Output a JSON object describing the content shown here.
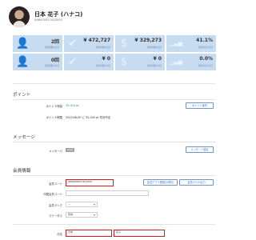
{
  "header": {
    "name": "日本 花子 (ハナコ)",
    "member_id": "A860000274U3000"
  },
  "stats": [
    {
      "icon": "user-icon",
      "glyph": "👤",
      "value": "2回",
      "label": "利用回数の合計"
    },
    {
      "icon": "check-icon",
      "glyph": "✔",
      "value": "¥ 472,727",
      "label": "利用金額の合計"
    },
    {
      "icon": "dollar-icon",
      "glyph": "$",
      "value": "¥ 329,273",
      "label": "利用金額の合計"
    },
    {
      "icon": "bar-chart-icon",
      "glyph": "▁▃▅",
      "value": "41.1%",
      "label": "利用割合の合計"
    },
    {
      "icon": "user-icon",
      "glyph": "👤",
      "value": "0回",
      "label": "利用回数の合計"
    },
    {
      "icon": "check-icon",
      "glyph": "✔",
      "value": "¥ 0",
      "label": "利用金額の合計"
    },
    {
      "icon": "dollar-icon",
      "glyph": "$",
      "value": "¥ 0",
      "label": "利用金額の合計"
    },
    {
      "icon": "bar-chart-icon",
      "glyph": "▁▃▅",
      "value": "0.0%",
      "label": "利用割合の合計"
    }
  ],
  "points": {
    "title": "ポイント",
    "balance_label": "ポイント残高",
    "balance_value": "35,000 pt",
    "expiry_label": "ポイント期限",
    "expiry_value": "2025/06/30 に 35,000 pt 失効予定",
    "action_button": "ポイント操作"
  },
  "message": {
    "title": "メッセージ",
    "label": "メッセージ",
    "badge": "未設定",
    "button": "メッセージ設定"
  },
  "member": {
    "title": "会員情報",
    "code_label": "会員コード",
    "code_value": "A86I0000274U3000",
    "proxy_code_label": "代替会員コード",
    "proxy_code_value": "",
    "rank_label": "会員ランク",
    "rank_value": "－",
    "status_label": "ステータス",
    "status_value": "有効",
    "app_button": "会員アプリ登録QR表示",
    "label_button": "会員ラベル出力",
    "name_label": "氏名",
    "last_name": "日本",
    "first_name": "花子"
  }
}
